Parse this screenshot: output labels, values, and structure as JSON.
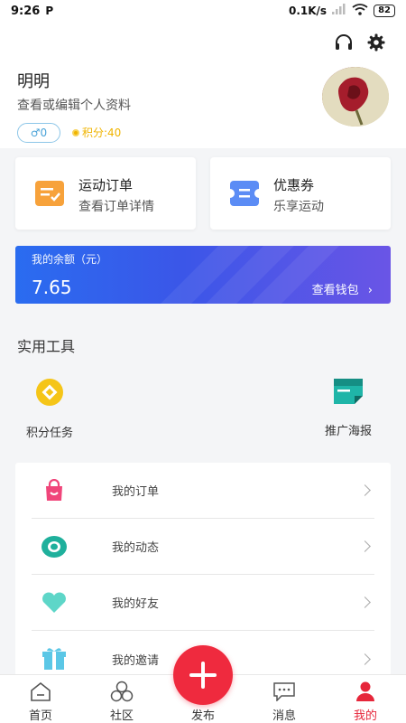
{
  "status_bar": {
    "time": "9:26",
    "app_indicator": "P",
    "speed": "0.1K/s",
    "battery": "82"
  },
  "header": {
    "user_name": "明明",
    "profile_hint": "查看或编辑个人资料",
    "gender_badge": "♂0",
    "points": "积分:40",
    "icons": [
      "headphones-icon",
      "gear-icon"
    ]
  },
  "cards": [
    {
      "title": "运动订单",
      "subtitle": "查看订单详情",
      "icon": "order-icon",
      "color": "#f7a23b"
    },
    {
      "title": "优惠券",
      "subtitle": "乐享运动",
      "icon": "coupon-icon",
      "color": "#5b8cf5"
    }
  ],
  "balance": {
    "label": "我的余额（元）",
    "amount": "7.65",
    "link": "查看钱包"
  },
  "tools": {
    "title": "实用工具",
    "items": [
      {
        "label": "积分任务",
        "icon": "points-task-icon",
        "color": "#f5c518"
      },
      {
        "label": "推广海报",
        "icon": "poster-icon",
        "color": "#1fb5a8"
      }
    ]
  },
  "menu": [
    {
      "label": "我的订单",
      "icon": "shopping-bag-icon",
      "color": "#f0457a"
    },
    {
      "label": "我的动态",
      "icon": "activity-icon",
      "color": "#1fb09c"
    },
    {
      "label": "我的好友",
      "icon": "heart-icon",
      "color": "#5ed6c8"
    },
    {
      "label": "我的邀请",
      "icon": "gift-icon",
      "color": "#5bc7e6"
    }
  ],
  "bottom_nav": [
    {
      "label": "首页",
      "icon": "home-icon"
    },
    {
      "label": "社区",
      "icon": "community-icon"
    },
    {
      "label": "发布",
      "icon": "plus-icon"
    },
    {
      "label": "消息",
      "icon": "message-icon"
    },
    {
      "label": "我的",
      "icon": "profile-icon"
    }
  ],
  "colors": {
    "accent": "#ef2a3e",
    "balance_start": "#2a6cf0",
    "balance_end": "#6a55e6"
  }
}
